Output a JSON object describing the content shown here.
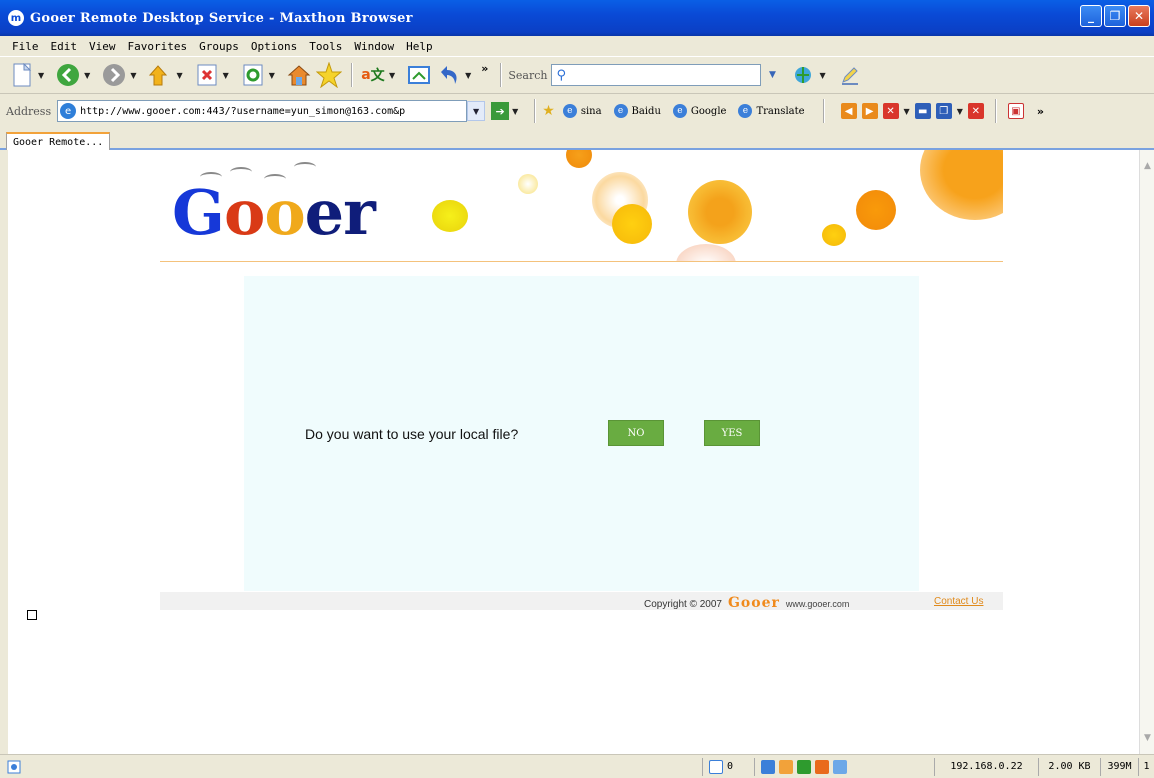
{
  "window": {
    "title": "Gooer Remote Desktop Service - Maxthon Browser",
    "app_icon": "m"
  },
  "menu": [
    "File",
    "Edit",
    "View",
    "Favorites",
    "Groups",
    "Options",
    "Tools",
    "Window",
    "Help"
  ],
  "toolbar": {
    "search_label": "Search",
    "search_value": "",
    "overflow": "»"
  },
  "address": {
    "label": "Address",
    "url": "http://www.gooer.com:443/?username=yun_simon@163.com&p",
    "overflow": "»"
  },
  "favorites": [
    "sina",
    "Baidu",
    "Google",
    "Translate"
  ],
  "tab": {
    "label": "Gooer Remote..."
  },
  "page": {
    "logo": {
      "g": "G",
      "o1": "o",
      "o2": "o",
      "er": "er"
    },
    "question": "Do you want to use your local file?",
    "no_label": "NO",
    "yes_label": "YES",
    "copyright_prefix": "Copyright © 2007",
    "copyright_logo": "Gooer",
    "copyright_site": "www.gooer.com",
    "contact": "Contact Us"
  },
  "status": {
    "count": "0",
    "ip": "192.168.0.22",
    "size": "2.00 KB",
    "memory": "399M",
    "last": "1"
  },
  "colors": {
    "titlebar": "#0A4AD6",
    "panel": "#F0FCFD",
    "button_green": "#69AC41",
    "contact_orange": "#E08A1B"
  }
}
